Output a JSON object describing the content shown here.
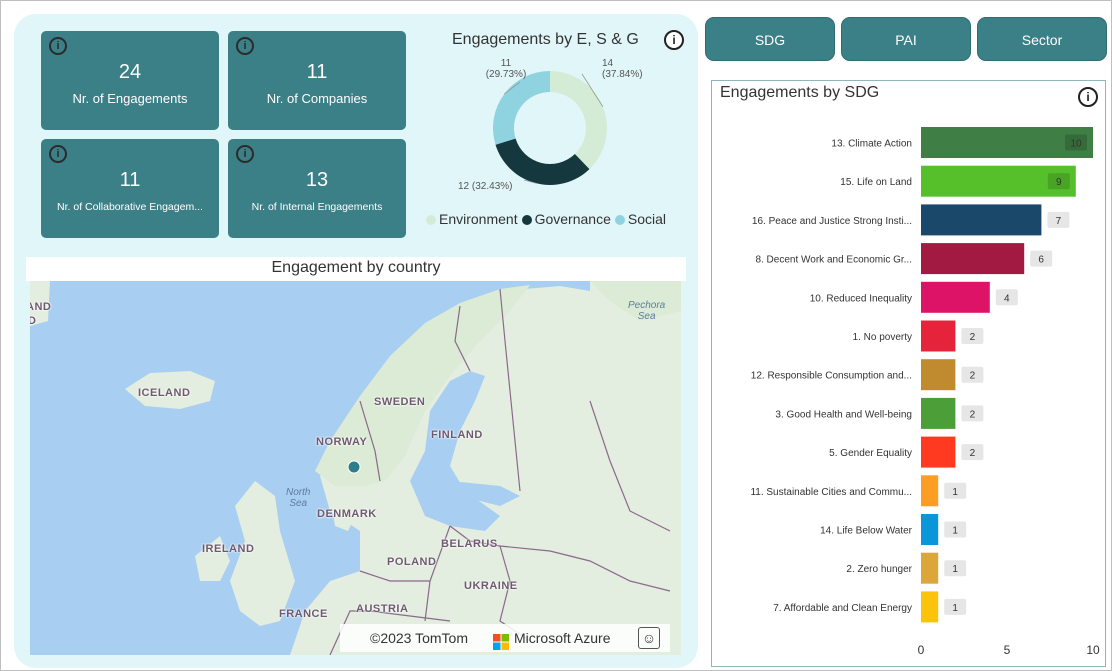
{
  "kpis": [
    {
      "value": "24",
      "label": "Nr. of Engagements"
    },
    {
      "value": "11",
      "label": "Nr. of Companies"
    },
    {
      "value": "11",
      "label": "Nr. of Collaborative Engagem..."
    },
    {
      "value": "13",
      "label": "Nr. of Internal Engagements"
    }
  ],
  "info_glyph": "i",
  "donut": {
    "title": "Engagements by E, S & G",
    "labels": {
      "environment": "14\n(37.84%)",
      "governance": "12 (32.43%)",
      "social": "11\n(29.73%)"
    }
  },
  "tabs": [
    "SDG",
    "PAI",
    "Sector"
  ],
  "map": {
    "title": "Engagement by country",
    "countries": [
      "ICELAND",
      "SWEDEN",
      "NORWAY",
      "FINLAND",
      "DENMARK",
      "IRELAND",
      "POLAND",
      "BELARUS",
      "UKRAINE",
      "FRANCE",
      "AUSTRIA",
      "AND",
      "D"
    ],
    "seas": [
      "Pechora\nSea",
      "North\nSea"
    ],
    "attribution": "©2023 TomTom",
    "provider": "Microsoft Azure"
  },
  "chart_data": [
    {
      "type": "pie",
      "title": "Engagements by E, S & G",
      "series": [
        {
          "name": "Environment",
          "value": 14,
          "percent": 37.84,
          "color": "#d4ecd5"
        },
        {
          "name": "Governance",
          "value": 12,
          "percent": 32.43,
          "color": "#15383f"
        },
        {
          "name": "Social",
          "value": 11,
          "percent": 29.73,
          "color": "#8fd3e0"
        }
      ]
    },
    {
      "type": "bar",
      "title": "Engagements by SDG",
      "categories": [
        "13. Climate Action",
        "15. Life on Land",
        "16. Peace and Justice Strong Insti...",
        "8. Decent Work and Economic Gr...",
        "10. Reduced Inequality",
        "1. No poverty",
        "12. Responsible Consumption and...",
        "3. Good Health and Well-being",
        "5. Gender Equality",
        "11. Sustainable Cities and Commu...",
        "14. Life Below Water",
        "2. Zero hunger",
        "7. Affordable and Clean Energy"
      ],
      "values": [
        10,
        9,
        7,
        6,
        4,
        2,
        2,
        2,
        2,
        1,
        1,
        1,
        1
      ],
      "colors": [
        "#3f7e44",
        "#56c02b",
        "#19486a",
        "#a21942",
        "#dd1367",
        "#e5243b",
        "#bf8b2e",
        "#4c9f38",
        "#ff3a21",
        "#fd9d24",
        "#0a97d9",
        "#dda63a",
        "#fcc30b"
      ],
      "xlim": [
        0,
        10
      ],
      "xticks": [
        "0",
        "5",
        "10"
      ]
    }
  ]
}
